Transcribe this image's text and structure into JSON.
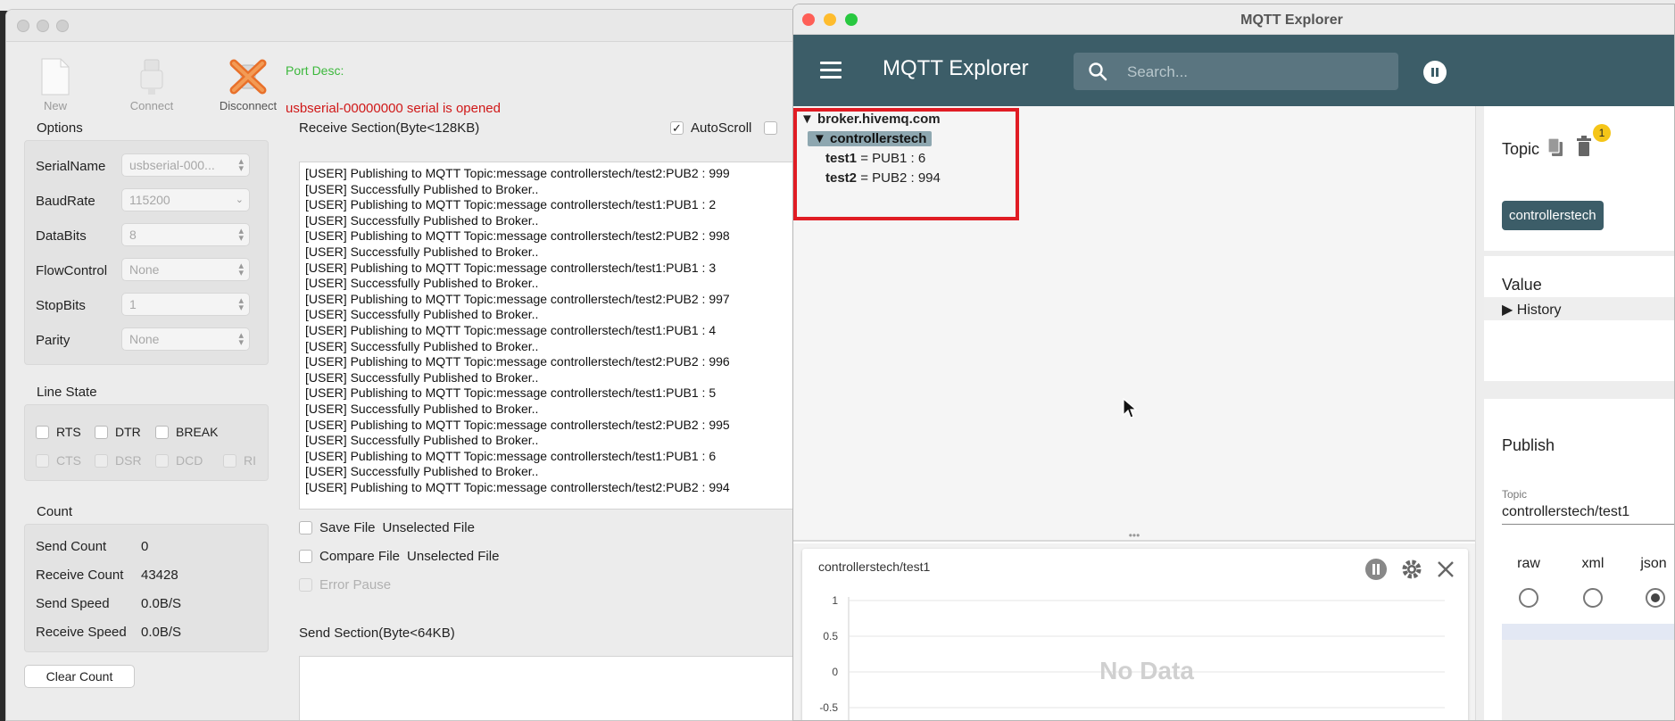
{
  "serial": {
    "toolbar": {
      "new_label": "New",
      "connect_label": "Connect",
      "disconnect_label": "Disconnect"
    },
    "port_desc_label": "Port Desc:",
    "status_text": "usbserial-00000000 serial is opened",
    "options": {
      "title": "Options",
      "rows": [
        {
          "name": "SerialName",
          "value": "usbserial-000..."
        },
        {
          "name": "BaudRate",
          "value": "115200"
        },
        {
          "name": "DataBits",
          "value": "8"
        },
        {
          "name": "FlowControl",
          "value": "None"
        },
        {
          "name": "StopBits",
          "value": "1"
        },
        {
          "name": "Parity",
          "value": "None"
        }
      ]
    },
    "line_state": {
      "title": "Line State",
      "rts": "RTS",
      "dtr": "DTR",
      "brk": "BREAK",
      "cts": "CTS",
      "dsr": "DSR",
      "dcd": "DCD",
      "ri": "RI"
    },
    "count": {
      "title": "Count",
      "send_count_label": "Send Count",
      "send_count": "0",
      "receive_count_label": "Receive Count",
      "receive_count": "43428",
      "send_speed_label": "Send Speed",
      "send_speed": "0.0B/S",
      "receive_speed_label": "Receive Speed",
      "receive_speed": "0.0B/S"
    },
    "clear_count_label": "Clear Count",
    "receive_section_label": "Receive Section(Byte<128KB)",
    "autoscroll_label": "AutoScroll",
    "receive_lines": [
      "[USER] Publishing to MQTT Topic:message controllerstech/test2:PUB2 : 999",
      "[USER] Successfully Published to Broker..",
      "[USER] Publishing to MQTT Topic:message controllerstech/test1:PUB1 : 2",
      "[USER] Successfully Published to Broker..",
      "[USER] Publishing to MQTT Topic:message controllerstech/test2:PUB2 : 998",
      "[USER] Successfully Published to Broker..",
      "[USER] Publishing to MQTT Topic:message controllerstech/test1:PUB1 : 3",
      "[USER] Successfully Published to Broker..",
      "[USER] Publishing to MQTT Topic:message controllerstech/test2:PUB2 : 997",
      "[USER] Successfully Published to Broker..",
      "[USER] Publishing to MQTT Topic:message controllerstech/test1:PUB1 : 4",
      "[USER] Successfully Published to Broker..",
      "[USER] Publishing to MQTT Topic:message controllerstech/test2:PUB2 : 996",
      "[USER] Successfully Published to Broker..",
      "[USER] Publishing to MQTT Topic:message controllerstech/test1:PUB1 : 5",
      "[USER] Successfully Published to Broker..",
      "[USER] Publishing to MQTT Topic:message controllerstech/test2:PUB2 : 995",
      "[USER] Successfully Published to Broker..",
      "[USER] Publishing to MQTT Topic:message controllerstech/test1:PUB1 : 6",
      "[USER] Successfully Published to Broker..",
      "[USER] Publishing to MQTT Topic:message controllerstech/test2:PUB2 : 994"
    ],
    "save_file_label": "Save File",
    "save_file_value": "Unselected File",
    "compare_file_label": "Compare File",
    "compare_file_value": "Unselected File",
    "error_pause_label": "Error Pause",
    "send_section_label": "Send Section(Byte<64KB)"
  },
  "mqtt": {
    "window_title": "MQTT Explorer",
    "app_title": "MQTT Explorer",
    "search_placeholder": "Search...",
    "tree": {
      "broker": "broker.hivemq.com",
      "group": "controllerstech",
      "items": [
        {
          "key": "test1",
          "value": "= PUB1 : 6"
        },
        {
          "key": "test2",
          "value": "= PUB2 : 994"
        }
      ]
    },
    "chart": {
      "topic": "controllerstech/test1",
      "no_data": "No Data",
      "yticks": [
        "1",
        "0.5",
        "0",
        "-0.5"
      ]
    },
    "side": {
      "topic_label": "Topic",
      "badge_count": "1",
      "topic_chip": "controllerstech",
      "value_label": "Value",
      "history_label": "History",
      "publish_label": "Publish",
      "publish_topic_caption": "Topic",
      "publish_topic_value": "controllerstech/test1",
      "formats": [
        "raw",
        "xml",
        "json"
      ],
      "selected_format": "json"
    }
  },
  "colors": {
    "appbar": "#3c5d68",
    "highlight_red": "#e01c24",
    "status_red": "#d01818",
    "port_green": "#3cb83c",
    "badge_yellow": "#f5c518"
  }
}
